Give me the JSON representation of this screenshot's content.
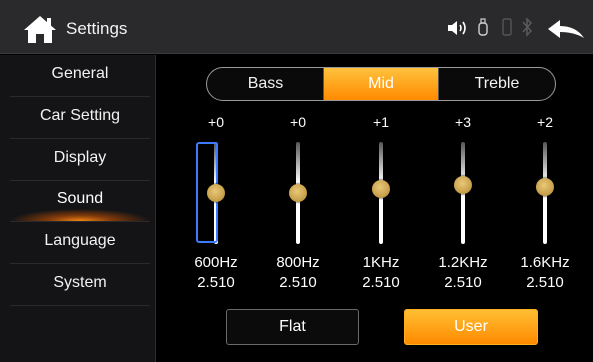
{
  "header": {
    "title": "Settings",
    "icons": [
      "home-icon",
      "volume-icon",
      "usb-icon",
      "phone-icon",
      "bluetooth-icon",
      "back-arrow-icon"
    ]
  },
  "sidebar": {
    "items": [
      {
        "label": "General"
      },
      {
        "label": "Car Setting"
      },
      {
        "label": "Display"
      },
      {
        "label": "Sound"
      },
      {
        "label": "Language"
      },
      {
        "label": "System"
      }
    ],
    "active": "Sound"
  },
  "tabs": {
    "items": [
      {
        "label": "Bass"
      },
      {
        "label": "Mid"
      },
      {
        "label": "Treble"
      }
    ],
    "selected": "Mid"
  },
  "eq": {
    "bands": [
      {
        "gain": "+0",
        "freq": "600Hz",
        "q": "2.510",
        "selected": true
      },
      {
        "gain": "+0",
        "freq": "800Hz",
        "q": "2.510",
        "selected": false
      },
      {
        "gain": "+1",
        "freq": "1KHz",
        "q": "2.510",
        "selected": false
      },
      {
        "gain": "+3",
        "freq": "1.2KHz",
        "q": "2.510",
        "selected": false
      },
      {
        "gain": "+2",
        "freq": "1.6KHz",
        "q": "2.510",
        "selected": false
      }
    ]
  },
  "presets": {
    "flat_label": "Flat",
    "user_label": "User",
    "selected": "User"
  },
  "colors": {
    "accent": "#ff9a1a",
    "selection": "#3b7bff",
    "header_bg": "#2a2a2c"
  }
}
